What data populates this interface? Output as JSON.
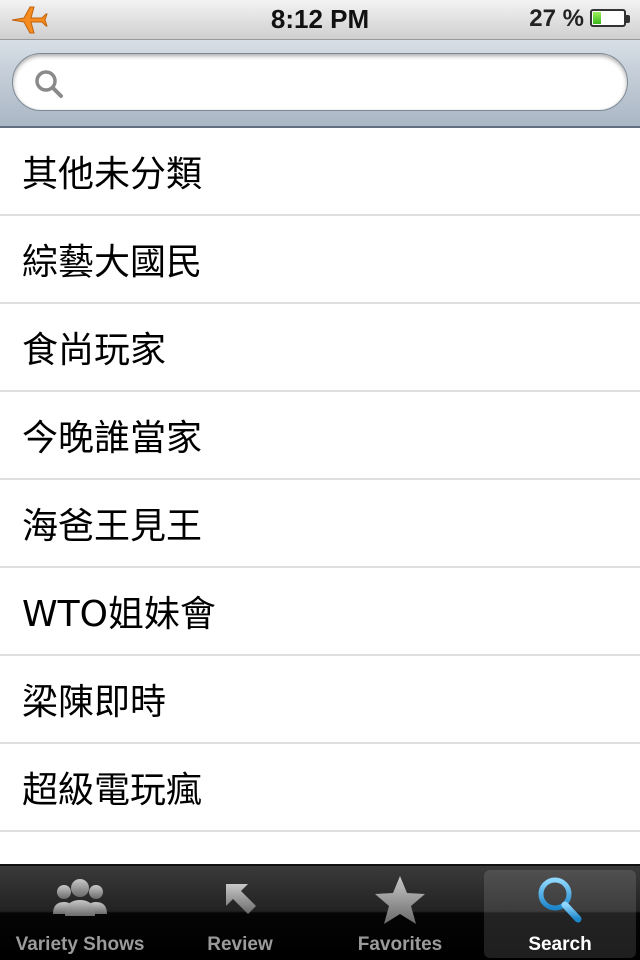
{
  "status_bar": {
    "time": "8:12 PM",
    "battery_text": "27 %",
    "battery_level": 0.27,
    "airplane_icon": "airplane-icon"
  },
  "search": {
    "placeholder": "",
    "value": "",
    "icon": "search-icon"
  },
  "list": {
    "items": [
      {
        "label": "其他未分類"
      },
      {
        "label": "綜藝大國民"
      },
      {
        "label": "食尚玩家"
      },
      {
        "label": "今晚誰當家"
      },
      {
        "label": "海爸王見王"
      },
      {
        "label": "WTO姐妹會"
      },
      {
        "label": "梁陳即時"
      },
      {
        "label": "超級電玩瘋"
      }
    ]
  },
  "tab_bar": {
    "tabs": [
      {
        "label": "Variety Shows",
        "icon": "people-icon",
        "selected": false
      },
      {
        "label": "Review",
        "icon": "arrow-icon",
        "selected": false
      },
      {
        "label": "Favorites",
        "icon": "star-icon",
        "selected": false
      },
      {
        "label": "Search",
        "icon": "search-icon",
        "selected": true
      }
    ]
  },
  "colors": {
    "accent_blue": "#2f9bdc",
    "tab_inactive": "#9b9b9b"
  }
}
